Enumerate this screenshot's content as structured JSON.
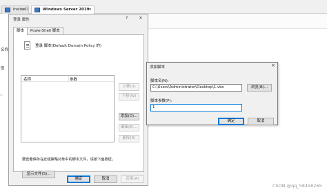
{
  "host": {
    "tabs": [
      {
        "label": "InsideCl"
      },
      {
        "label": "Windows Server 2019"
      }
    ],
    "left_labels": [
      "名称",
      "取",
      "i"
    ]
  },
  "dialog_main": {
    "title": "登录 属性",
    "tabs": [
      "脚本",
      "PowerShell 脚本"
    ],
    "heading": "登录 脚本(Default Domain Policy 的)",
    "columns": [
      "名称",
      "参数"
    ],
    "buttons": {
      "up": "上移(U)",
      "down": "下移(W)",
      "add": "添加(D)...",
      "edit": "编辑(E)...",
      "remove": "删除(R)"
    },
    "note": "要查看保存在此组策略对象中的脚本文件，请按下面按钮。",
    "show_files": "显示文件(S)...",
    "ok": "确定",
    "cancel": "取消",
    "apply": "应用(A)"
  },
  "dialog_add": {
    "title": "添加脚本",
    "name_label": "脚本名(N):",
    "name_value": "C:\\Users\\Administrator\\Desktop\\1.vbs",
    "browse": "浏览(B)...",
    "params_label": "脚本参数(P):",
    "params_value": "1",
    "ok": "确定",
    "cancel": "取消"
  },
  "watermark": "CSDN @qq_58458265"
}
